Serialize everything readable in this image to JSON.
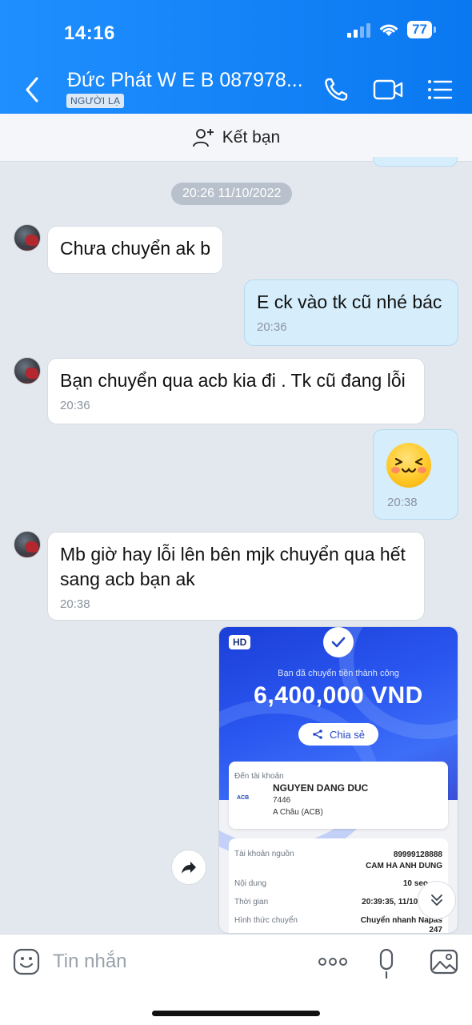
{
  "status_bar": {
    "time": "14:16",
    "battery": "77"
  },
  "header": {
    "title": "Đức Phát W E B 087978...",
    "badge": "NGƯỜI LẠ",
    "icons": [
      "back-icon",
      "phone-icon",
      "video-call-icon",
      "menu-list-icon"
    ]
  },
  "friend_bar": {
    "label": "Kết bạn",
    "icon": "add-person-icon"
  },
  "date_divider": "20:26 11/10/2022",
  "messages": [
    {
      "direction": "in",
      "text": "Chưa chuyển ak b"
    },
    {
      "direction": "out",
      "text": "E ck vào tk cũ nhé bác",
      "time": "20:36"
    },
    {
      "direction": "in",
      "text": "Bạn chuyển qua acb kia đi . Tk cũ đang lỗi",
      "time": "20:36"
    },
    {
      "direction": "out",
      "sticker": "laughing-face-sticker",
      "time": "20:38"
    },
    {
      "direction": "in",
      "text": "Mb giờ hay lỗi lên bên mjk chuyển qua hết sang acb bạn ak",
      "time": "20:38"
    }
  ],
  "receipt": {
    "hd": "HD",
    "success": "Bạn đã chuyển tiền thành công",
    "amount": "6,400,000 VND",
    "share": "Chia sẻ",
    "dest_label": "Đến tài khoản",
    "bank_logo": "ACB",
    "dest_name": "NGUYEN DANG DUC",
    "dest_account": "7446",
    "dest_bank": "A Châu (ACB)",
    "rows": [
      {
        "label": "Tài khoản nguồn",
        "value": "89999128888",
        "value2": "CAM HA ANH DUNG"
      },
      {
        "label": "Nội dung",
        "value": "10 seo"
      },
      {
        "label": "Thời gian",
        "value": "20:39:35, 11/10,"
      },
      {
        "label": "Hình thức chuyển",
        "value": "Chuyển nhanh Napas",
        "value2": "247"
      }
    ]
  },
  "input_bar": {
    "placeholder": "Tin nhắn",
    "icons": [
      "emoji-icon",
      "more-icon",
      "microphone-icon",
      "image-icon"
    ]
  }
}
